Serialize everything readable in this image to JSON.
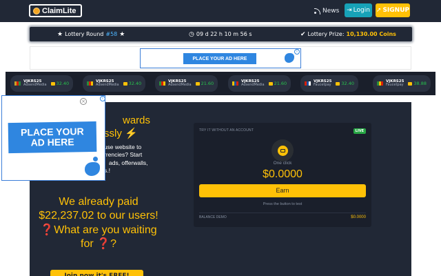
{
  "navbar": {
    "brand": "ClaimLite",
    "news_label": "News",
    "login_label": "Login",
    "signup_label": "SIGNUP"
  },
  "lottery": {
    "round_label": "Lottery Round",
    "round_number": "#58",
    "countdown": "09 d 22 h 10 m 56 s",
    "prize_label": "Lottery Prize:",
    "prize_value": "10,130.00 Coins"
  },
  "ads": {
    "banner_text": "PLACE YOUR AD HERE",
    "overlay_line1": "PLACE YOUR",
    "overlay_line2": "AD HERE"
  },
  "ticker": [
    {
      "user": "VJKRS25",
      "source": "AdsendMedia",
      "amount": "32.40",
      "flag": [
        "#c9a227",
        "#d81e05",
        "#2a8c3a"
      ]
    },
    {
      "user": "VJKRS25",
      "source": "AdsendMedia",
      "amount": "32.40",
      "flag": [
        "#2a8c3a",
        "#d81e05",
        "#f2c200"
      ]
    },
    {
      "user": "VJKRS25",
      "source": "AdsendMedia",
      "amount": "21.60",
      "flag": [
        "#2a8c3a",
        "#d81e05",
        "#f2c200"
      ]
    },
    {
      "user": "VJKRS25",
      "source": "AdsendMedia",
      "amount": "21.60",
      "flag": [
        "#f2c200",
        "#1a4fa0",
        "#d81e05"
      ]
    },
    {
      "user": "VJKRS25",
      "source": "Faucetpay",
      "amount": "32.40",
      "flag": [
        "#d81e05",
        "#1a4fa0",
        "#ffffff"
      ]
    },
    {
      "user": "VJKRS25",
      "source": "Faucetpay",
      "amount": "38.88",
      "flag": [
        "#2a8c3a",
        "#f2c200",
        "#d81e05"
      ]
    }
  ],
  "hero": {
    "title_part": "wards",
    "title_part2": "ssly",
    "text_lines": [
      "-use website to",
      "rrencies? Start",
      "ads, offerwalls,",
      "s.!"
    ],
    "paid_text": "We already paid $22,237.02 to our users! ❓What are you waiting for ❓?",
    "join_label": "Join now it's FREE!"
  },
  "try": {
    "header": "TRY IT WITHOUT AN ACCOUNT",
    "live": "LIVE",
    "one_click": "One click",
    "balance": "$0.0000",
    "earn_label": "Earn",
    "press_text": "Press the button to test",
    "demo_label": "BALANCE DEMO",
    "demo_value": "$0.0000"
  },
  "colors": {
    "navbar": "#212836",
    "accent": "#ffc107",
    "info": "#17a2b8",
    "ad_blue": "#2f86e0"
  }
}
